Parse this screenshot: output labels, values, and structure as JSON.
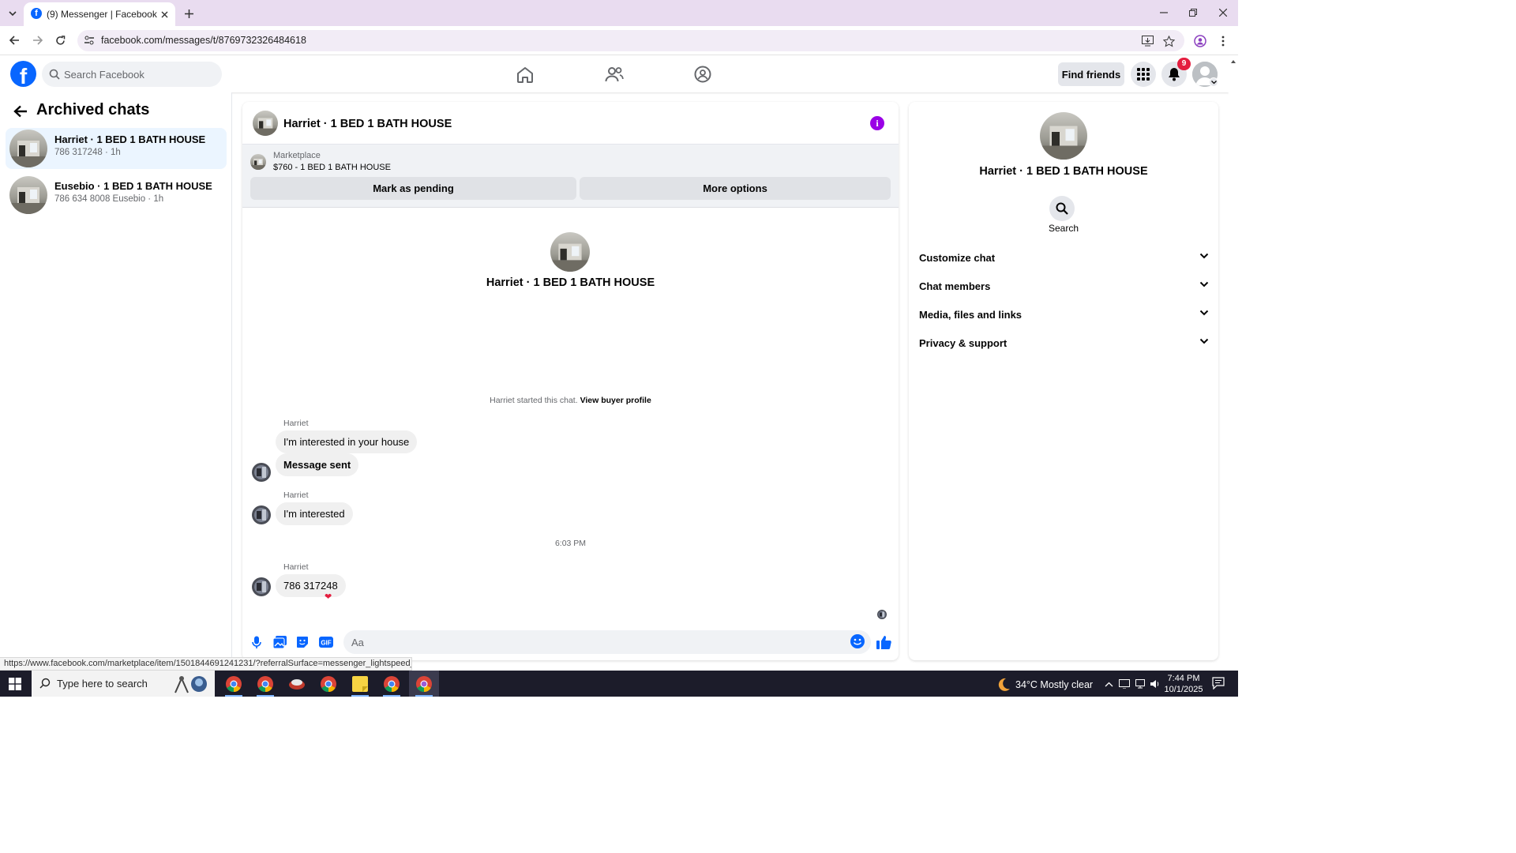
{
  "browser": {
    "tab_title": "(9) Messenger | Facebook",
    "url": "facebook.com/messages/t/8769732326484618",
    "status_url": "https://www.facebook.com/marketplace/item/1501844691241231/?referralSurface=messenger_lightspeed_banner&r..."
  },
  "fb_nav": {
    "logo": "f",
    "search_placeholder": "Search Facebook",
    "find_friends": "Find friends",
    "notification_count": "9"
  },
  "left": {
    "title": "Archived chats",
    "chats": [
      {
        "name": "Harriet · 1 BED 1 BATH HOUSE",
        "sub": "786 317248 · 1h"
      },
      {
        "name": "Eusebio · 1 BED 1 BATH HOUSE",
        "sub": "786 634 8008 Eusebio · 1h"
      }
    ]
  },
  "conversation": {
    "title": "Harriet · 1 BED 1 BATH HOUSE",
    "marketplace": {
      "label": "Marketplace",
      "listing": "$760 - 1 BED 1 BATH HOUSE",
      "pending_btn": "Mark as pending",
      "options_btn": "More options"
    },
    "intro_title": "Harriet · 1 BED 1 BATH HOUSE",
    "started_text": "Harriet started this chat.",
    "started_link": "View buyer profile",
    "messages": [
      {
        "sender": "Harriet",
        "text": "I'm interested in your house"
      },
      {
        "text": "Message sent"
      },
      {
        "sender": "Harriet",
        "text": "I'm interested"
      },
      {
        "time": "6:03 PM"
      },
      {
        "sender": "Harriet",
        "text": "786 317248",
        "reaction": "❤"
      }
    ],
    "input_placeholder": "Aa"
  },
  "right_panel": {
    "title": "Harriet · 1 BED 1 BATH HOUSE",
    "search_label": "Search",
    "sections": [
      "Customize chat",
      "Chat members",
      "Media, files and links",
      "Privacy & support"
    ]
  },
  "taskbar": {
    "search_placeholder": "Type here to search",
    "weather": "34°C  Mostly clear",
    "time": "7:44 PM",
    "date": "10/1/2025"
  },
  "colors": {
    "fb_blue": "#0866ff",
    "active_chat_bg": "#ebf5ff",
    "info_purple": "#9a00e6",
    "badge_red": "#e41e3f",
    "chrome_tabbar": "#e9dcf0"
  }
}
